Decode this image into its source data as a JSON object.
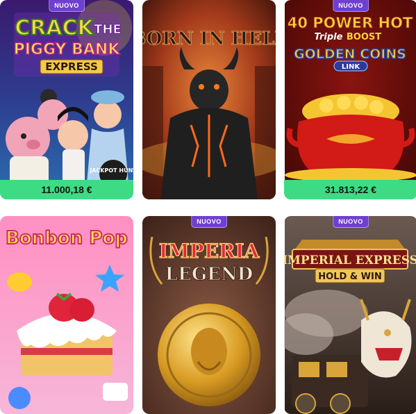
{
  "tiles": [
    {
      "id": "crack-the-piggy-bank",
      "badge": "NUOVO",
      "logo": [
        "CRACK",
        "THE",
        "PIGGY BANK",
        "EXPRESS"
      ],
      "jackpot": "11.000,18 €",
      "corner_logo": "JACKPOT HUNT"
    },
    {
      "id": "born-in-hell",
      "logo": [
        "BORN IN HELL"
      ]
    },
    {
      "id": "40-power-hot",
      "badge": "NUOVO",
      "logo": [
        "40 POWER HOT",
        "Triple",
        "BOOST",
        "GOLDEN COINS",
        "LINK"
      ],
      "jackpot": "31.813,22 €"
    },
    {
      "id": "bonbon-pop",
      "logo": [
        "Bonbon Pop"
      ]
    },
    {
      "id": "imperia-legend",
      "badge": "NUOVO",
      "logo": [
        "IMPERIA",
        "LEGEND"
      ]
    },
    {
      "id": "imperial-express",
      "badge": "NUOVO",
      "logo": [
        "IMPERIAL EXPRESS",
        "HOLD & WIN"
      ]
    }
  ],
  "colors": {
    "badge": "#6f3fd0",
    "jackpot_bar": "#3ddc84"
  }
}
